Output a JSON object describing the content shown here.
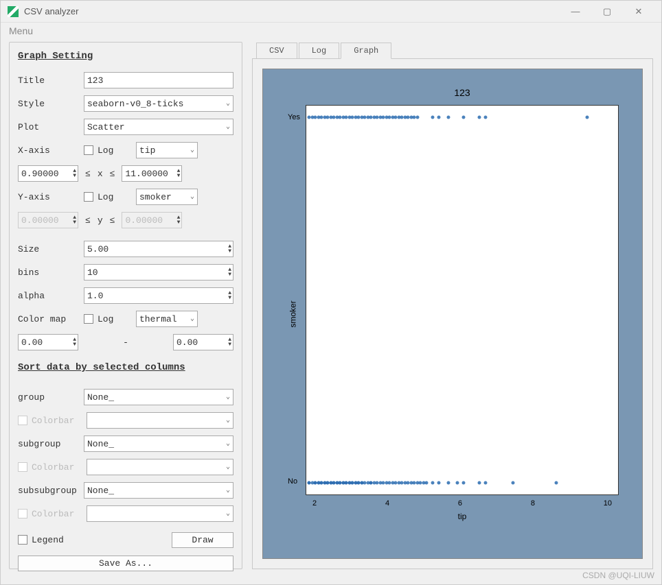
{
  "window": {
    "title": "CSV analyzer"
  },
  "menubar": {
    "menu": "Menu"
  },
  "tabs": {
    "csv": "CSV",
    "log": "Log",
    "graph": "Graph"
  },
  "section": {
    "graph_setting": "Graph Setting",
    "sort": "Sort data by selected columns"
  },
  "labels": {
    "title": "Title",
    "style": "Style",
    "plot": "Plot",
    "xaxis": "X-axis",
    "yaxis": "Y-axis",
    "log": "Log",
    "size": "Size",
    "bins": "bins",
    "alpha": "alpha",
    "cmap": "Color map",
    "group": "group",
    "subgroup": "subgroup",
    "subsubgroup": "subsubgroup",
    "colorbar": "Colorbar",
    "legend": "Legend"
  },
  "values": {
    "title": "123",
    "style": "seaborn-v0_8-ticks",
    "plot": "Scatter",
    "xcol": "tip",
    "ycol": "smoker",
    "xmin": "0.90000",
    "xmax": "11.00000",
    "ymin": "0.00000",
    "ymax": "0.00000",
    "size": "5.00",
    "bins": "10",
    "alpha": "1.0",
    "cmap": "thermal",
    "cmin": "0.00",
    "cmax": "0.00",
    "group": "None_",
    "subgroup": "None_",
    "subsubgroup": "None_",
    "rangex": "x",
    "rangey": "y",
    "le": "≤",
    "dash": "-"
  },
  "buttons": {
    "draw": "Draw",
    "saveas": "Save As..."
  },
  "chart_data": {
    "type": "scatter",
    "title": "123",
    "xlabel": "tip",
    "ylabel": "smoker",
    "xlim": [
      0.9,
      11.0
    ],
    "xticks": [
      2,
      4,
      6,
      8,
      10
    ],
    "categories": [
      "Yes",
      "No"
    ],
    "series": [
      {
        "name": "Yes",
        "x": [
          1.0,
          1.1,
          1.2,
          1.3,
          1.4,
          1.5,
          1.6,
          1.7,
          1.8,
          1.9,
          2.0,
          2.1,
          2.2,
          2.3,
          2.4,
          2.5,
          2.6,
          2.7,
          2.8,
          2.9,
          3.0,
          3.1,
          3.2,
          3.3,
          3.4,
          3.5,
          3.6,
          3.7,
          3.8,
          3.9,
          4.0,
          4.1,
          4.2,
          4.3,
          4.4,
          4.5,
          5.0,
          5.2,
          5.5,
          6.0,
          6.5,
          6.7,
          10.0
        ]
      },
      {
        "name": "No",
        "x": [
          1.0,
          1.0,
          1.1,
          1.2,
          1.2,
          1.3,
          1.3,
          1.4,
          1.4,
          1.5,
          1.5,
          1.6,
          1.6,
          1.7,
          1.7,
          1.8,
          1.8,
          1.9,
          1.9,
          2.0,
          2.0,
          2.1,
          2.1,
          2.2,
          2.2,
          2.3,
          2.3,
          2.4,
          2.4,
          2.5,
          2.5,
          2.6,
          2.6,
          2.7,
          2.7,
          2.8,
          2.9,
          3.0,
          3.0,
          3.1,
          3.2,
          3.3,
          3.4,
          3.5,
          3.6,
          3.7,
          3.8,
          3.9,
          4.0,
          4.1,
          4.2,
          4.3,
          4.4,
          4.5,
          4.6,
          4.7,
          4.8,
          5.0,
          5.2,
          5.5,
          5.8,
          6.0,
          6.5,
          6.7,
          7.6,
          9.0
        ]
      }
    ]
  },
  "watermark": "CSDN @UQI-LIUW"
}
